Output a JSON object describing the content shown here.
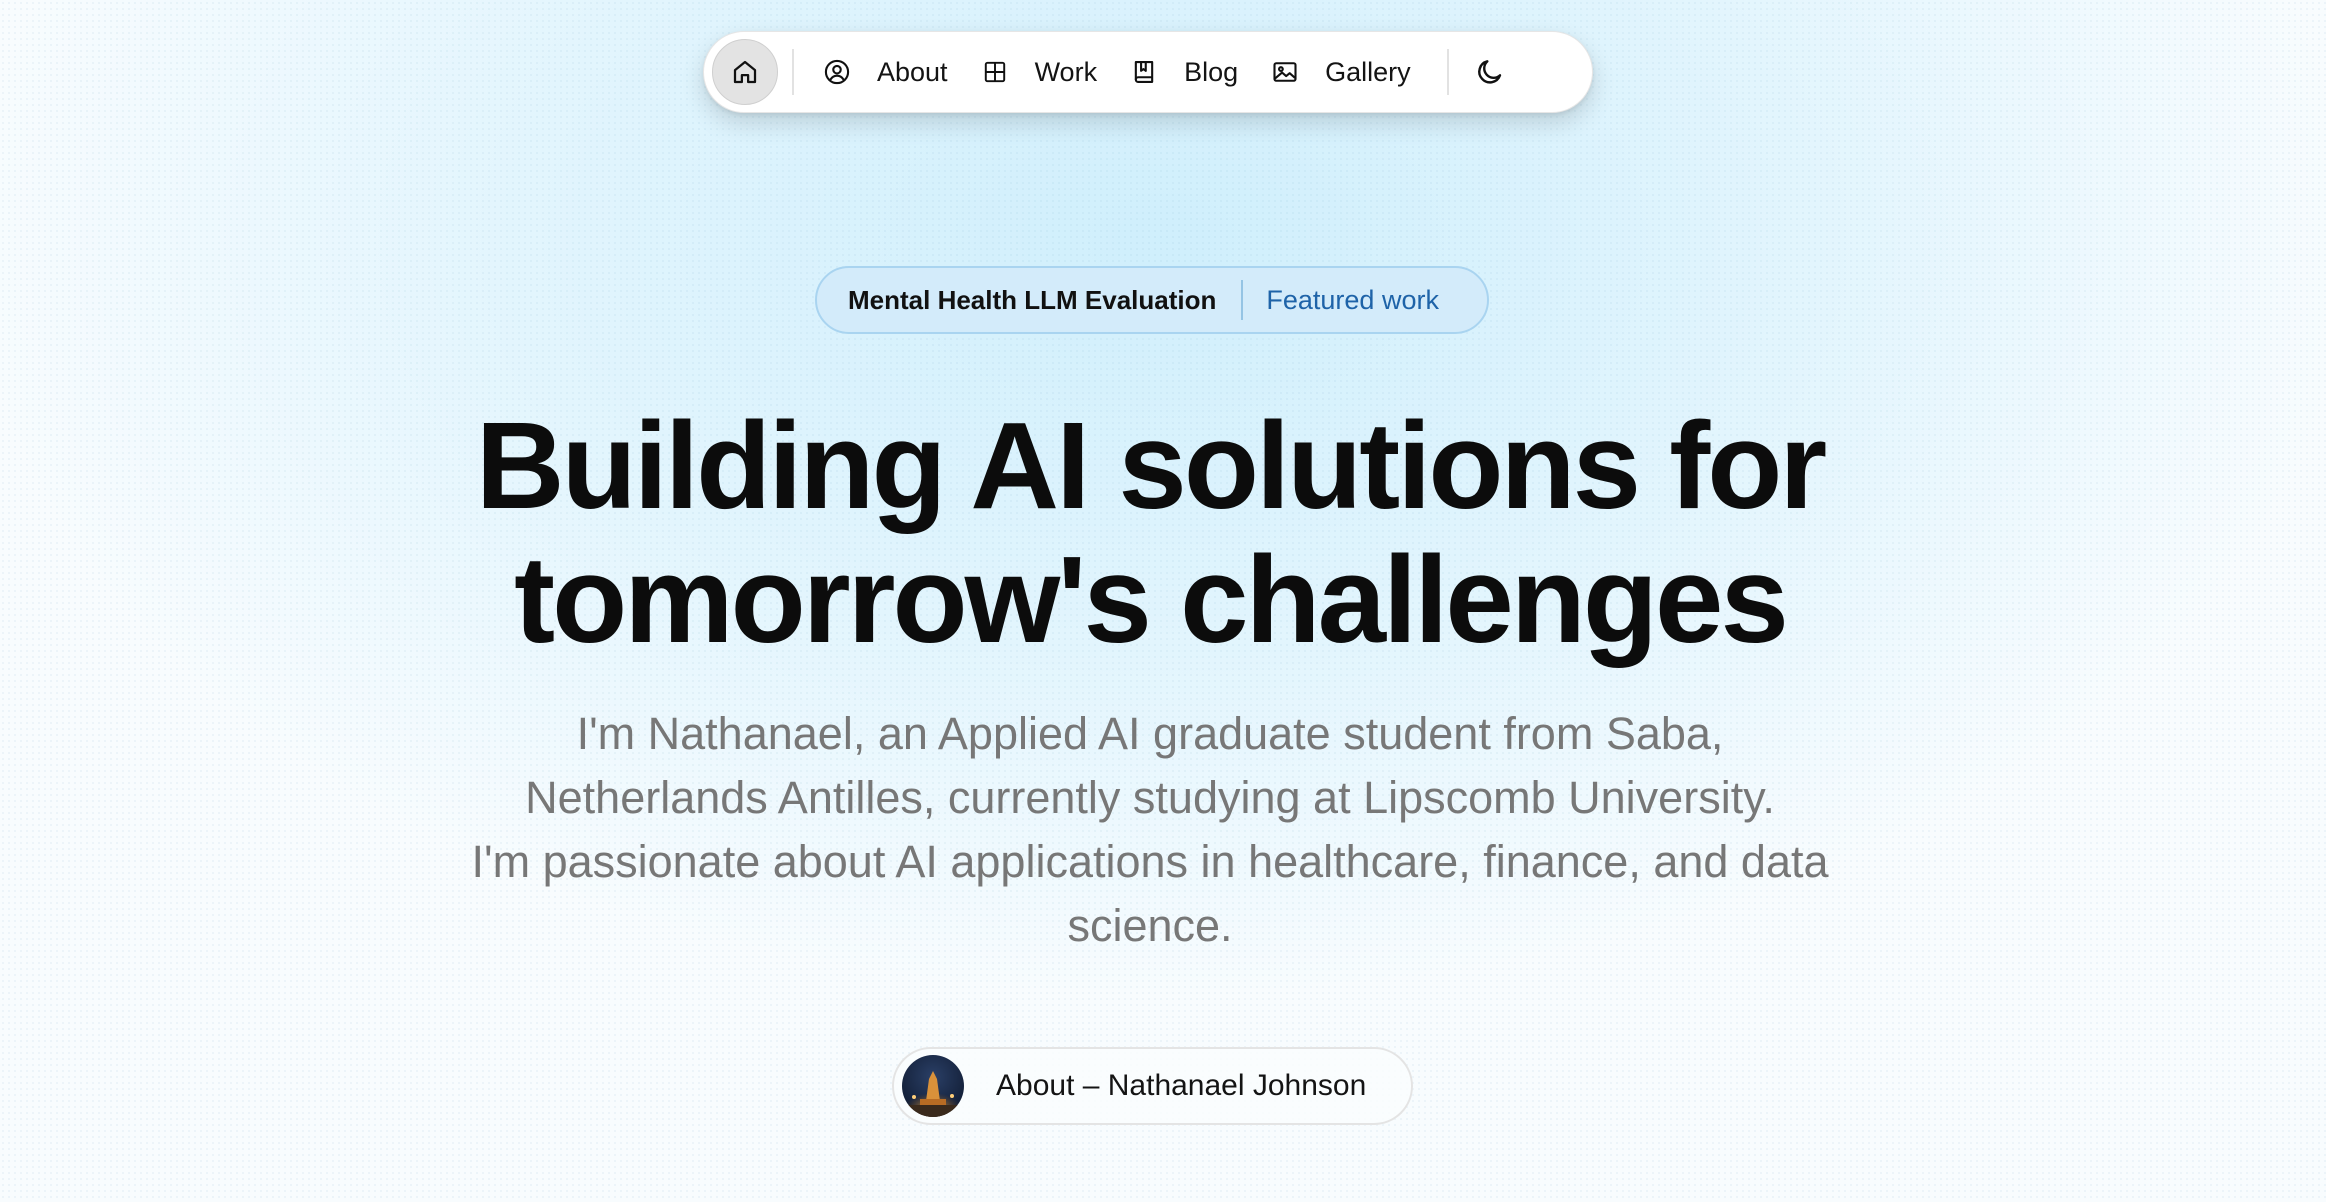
{
  "nav": {
    "home_icon": "home-icon",
    "items": [
      {
        "label": "About",
        "icon": "user-circle-icon"
      },
      {
        "label": "Work",
        "icon": "grid-icon"
      },
      {
        "label": "Blog",
        "icon": "book-icon"
      },
      {
        "label": "Gallery",
        "icon": "image-icon"
      }
    ],
    "theme_icon": "moon-icon"
  },
  "featured": {
    "title": "Mental Health LLM Evaluation",
    "link": "Featured work",
    "accent": "#1e63a8"
  },
  "hero": {
    "headline_line1": "Building AI solutions for",
    "headline_line2": "tomorrow's challenges",
    "intro_line1": "I'm Nathanael, an Applied AI graduate student from Saba,",
    "intro_line2": "Netherlands Antilles, currently studying at Lipscomb University.",
    "intro_line3": "I'm passionate about AI applications in healthcare, finance, and data",
    "intro_line4": "science."
  },
  "about_button": {
    "label": "About – Nathanael Johnson",
    "avatar": "avatar"
  }
}
